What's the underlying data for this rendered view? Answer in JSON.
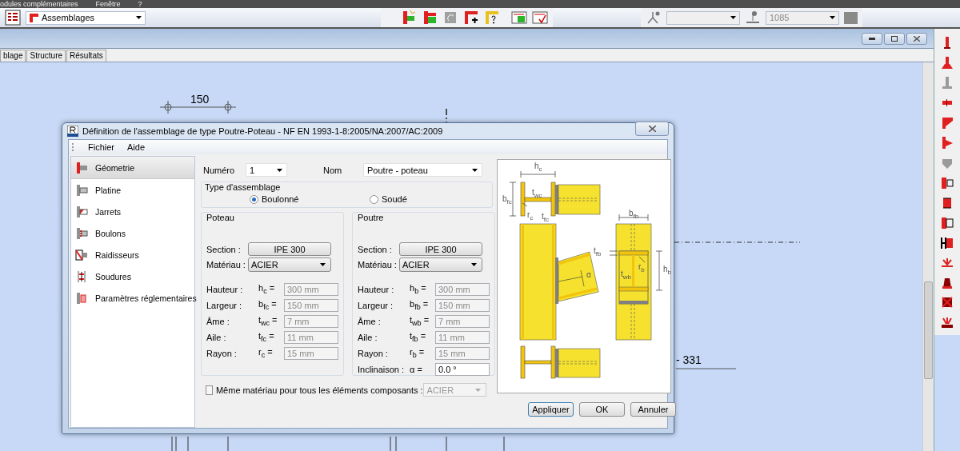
{
  "menu_bar": {
    "items": [
      "odules complémentaires",
      "Fenêtre",
      "?"
    ]
  },
  "toolbar": {
    "module_select": {
      "value": "Assemblages"
    },
    "level_select": {
      "value": "1085"
    }
  },
  "document_window": {
    "tabs": [
      {
        "label": "blage",
        "selected": false
      },
      {
        "label": "Structure",
        "selected": false
      },
      {
        "label": "Résultats",
        "selected": false
      }
    ]
  },
  "canvas": {
    "dimension_labels": [
      "150",
      "- 331"
    ]
  },
  "dialog": {
    "title": "Définition de l'assemblage de type Poutre-Poteau - NF EN 1993-1-8:2005/NA:2007/AC:2009",
    "menu": [
      "Fichier",
      "Aide"
    ],
    "nav": [
      {
        "label": "Géometrie",
        "selected": true
      },
      {
        "label": "Platine",
        "selected": false
      },
      {
        "label": "Jarrets",
        "selected": false
      },
      {
        "label": "Boulons",
        "selected": false
      },
      {
        "label": "Raidisseurs",
        "selected": false
      },
      {
        "label": "Soudures",
        "selected": false
      },
      {
        "label": "Paramètres réglementaires",
        "selected": false
      }
    ],
    "numero": {
      "label": "Numéro",
      "value": "1"
    },
    "nom": {
      "label": "Nom",
      "value": "Poutre - poteau"
    },
    "assembly_type": {
      "title": "Type d'assemblage",
      "options": [
        {
          "label": "Boulonné",
          "selected": true
        },
        {
          "label": "Soudé",
          "selected": false
        }
      ]
    },
    "groups": [
      {
        "title": "Poteau",
        "section_label": "Section :",
        "section": "IPE 300",
        "material_label": "Matériau :",
        "material": "ACIER",
        "rows": [
          {
            "label": "Hauteur :",
            "symbol": "h$_{c}$ =",
            "value": "300 mm",
            "kind": "readonly"
          },
          {
            "label": "Largeur :",
            "symbol": "b$_{fc}$ =",
            "value": "150 mm",
            "kind": "readonly"
          },
          {
            "label": "Âme :",
            "symbol": "t$_{wc}$ =",
            "value": "7 mm",
            "kind": "readonly"
          },
          {
            "label": "Aile :",
            "symbol": "t$_{fc}$ =",
            "value": "11 mm",
            "kind": "readonly"
          },
          {
            "label": "Rayon :",
            "symbol": "r$_{c}$ =",
            "value": "15 mm",
            "kind": "readonly"
          }
        ]
      },
      {
        "title": "Poutre",
        "section_label": "Section :",
        "section": "IPE 300",
        "material_label": "Matériau :",
        "material": "ACIER",
        "rows": [
          {
            "label": "Hauteur :",
            "symbol": "h$_{b}$ =",
            "value": "300 mm",
            "kind": "readonly"
          },
          {
            "label": "Largeur :",
            "symbol": "b$_{fb}$ =",
            "value": "150 mm",
            "kind": "readonly"
          },
          {
            "label": "Âme :",
            "symbol": "t$_{wb}$ =",
            "value": "7 mm",
            "kind": "readonly"
          },
          {
            "label": "Aile :",
            "symbol": "t$_{fb}$ =",
            "value": "11 mm",
            "kind": "readonly"
          },
          {
            "label": "Rayon :",
            "symbol": "r$_{b}$ =",
            "value": "15 mm",
            "kind": "readonly"
          },
          {
            "label": "Inclinaison :",
            "symbol": "α =",
            "value": "0.0 °",
            "kind": "input"
          }
        ]
      }
    ],
    "same_material": {
      "label": "Même matériau pour tous les éléments composants :",
      "checked": false,
      "value": "ACIER"
    },
    "diagram_labels": [
      "h$_{c}$",
      "b$_{fc}$",
      "t$_{wc}$",
      "r$_{c}$",
      "t$_{fc}$",
      "α",
      "b$_{fb}$",
      "t$_{fb}$",
      "h$_{b}$",
      "t$_{wb}$",
      "r$_{b}$"
    ],
    "buttons": [
      "Appliquer",
      "OK",
      "Annuler"
    ]
  }
}
